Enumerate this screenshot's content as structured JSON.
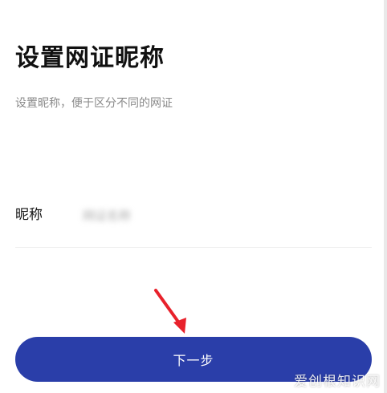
{
  "page": {
    "title": "设置网证昵称",
    "subtitle": "设置昵称，便于区分不同的网证"
  },
  "form": {
    "nickname_label": "昵称",
    "nickname_value": "网证名称"
  },
  "actions": {
    "next_label": "下一步"
  },
  "watermark": {
    "text": "爱创根知识网"
  },
  "colors": {
    "primary_button": "#2a3ea9",
    "arrow": "#e8212b",
    "title_text": "#111111",
    "subtitle_text": "#8a8a8a"
  },
  "icons": {
    "annotation": "red-arrow-icon"
  }
}
